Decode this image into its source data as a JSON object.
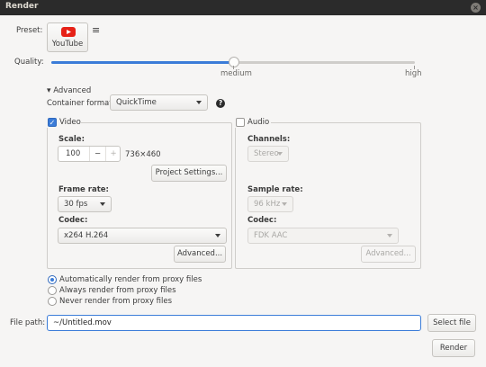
{
  "window": {
    "title": "Render",
    "close_glyph": "×"
  },
  "preset": {
    "label": "Preset:",
    "button_label": "YouTube",
    "menu_icon_glyph": "≡"
  },
  "quality": {
    "label": "Quality:",
    "level_medium": "medium",
    "level_high": "high",
    "value_fraction": 0.5
  },
  "advanced": {
    "toggle_label": "Advanced",
    "toggle_glyph": "▾"
  },
  "container": {
    "label": "Container format:",
    "value": "QuickTime",
    "help_glyph": "?"
  },
  "video": {
    "enabled": true,
    "label": "Video",
    "check_glyph": "✓",
    "scale_label": "Scale:",
    "scale_value": "100",
    "minus_glyph": "−",
    "plus_glyph": "+",
    "resolution": "736×460",
    "project_settings_label": "Project Settings...",
    "frame_rate_label": "Frame rate:",
    "frame_rate_value": "30 fps",
    "codec_label": "Codec:",
    "codec_value": "x264 H.264",
    "advanced_label": "Advanced..."
  },
  "audio": {
    "enabled": false,
    "label": "Audio",
    "channels_label": "Channels:",
    "channels_value": "Stereo",
    "sample_rate_label": "Sample rate:",
    "sample_rate_value": "96 kHz",
    "codec_label": "Codec:",
    "codec_value": "FDK AAC",
    "advanced_label": "Advanced..."
  },
  "proxy_options": [
    {
      "label": "Automatically render from proxy files",
      "selected": true
    },
    {
      "label": "Always render from proxy files",
      "selected": false
    },
    {
      "label": "Never render from proxy files",
      "selected": false
    }
  ],
  "file": {
    "label": "File path:",
    "value": "~/Untitled.mov",
    "select_label": "Select file"
  },
  "render_label": "Render",
  "colors": {
    "accent": "#3b7cd8",
    "youtube_red": "#e62117",
    "titlebar": "#2b2b2b"
  }
}
